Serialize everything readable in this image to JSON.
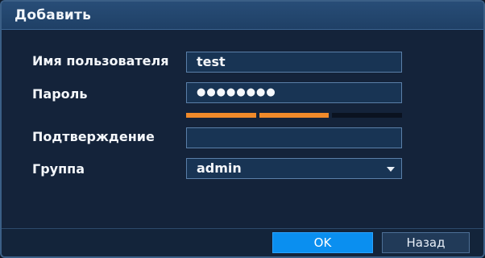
{
  "dialog": {
    "title": "Добавить"
  },
  "form": {
    "username": {
      "label": "Имя пользователя",
      "value": "test"
    },
    "password": {
      "label": "Пароль",
      "value": "●●●●●●●●"
    },
    "password_strength": {
      "level": 2,
      "max": 3
    },
    "confirm": {
      "label": "Подтверждение",
      "value": ""
    },
    "group": {
      "label": "Группа",
      "value": "admin"
    }
  },
  "buttons": {
    "ok": "OK",
    "back": "Назад"
  },
  "colors": {
    "title_bar": "#284d77",
    "dialog_bg": "#14233a",
    "field_bg": "#183454",
    "strength_on": "#f08a2a",
    "ok_button": "#0a8ff0"
  }
}
